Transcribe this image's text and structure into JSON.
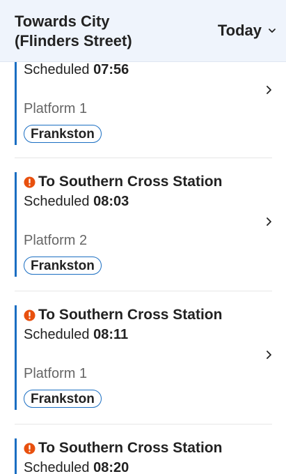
{
  "header": {
    "title_line1": "Towards City",
    "title_line2": "(Flinders Street)",
    "day_selected": "Today"
  },
  "departures": [
    {
      "destination": "",
      "scheduled_label": "Scheduled",
      "scheduled_time": "07:56",
      "platform": "Platform 1",
      "line": "Frankston",
      "has_alert": false
    },
    {
      "destination": "To Southern Cross Station",
      "scheduled_label": "Scheduled",
      "scheduled_time": "08:03",
      "platform": "Platform 2",
      "line": "Frankston",
      "has_alert": true
    },
    {
      "destination": "To Southern Cross Station",
      "scheduled_label": "Scheduled",
      "scheduled_time": "08:11",
      "platform": "Platform 1",
      "line": "Frankston",
      "has_alert": true
    },
    {
      "destination": "To Southern Cross Station",
      "scheduled_label": "Scheduled",
      "scheduled_time": "08:20",
      "platform": "",
      "line": "",
      "has_alert": true
    }
  ],
  "colors": {
    "header_bg": "#eff4fc",
    "accent_blue": "#1a6ec2",
    "alert_orange": "#e8500e"
  },
  "icons": {
    "alert": "alert-circle-icon",
    "chevron_right": "chevron-right-icon",
    "chevron_down": "chevron-down-icon"
  }
}
